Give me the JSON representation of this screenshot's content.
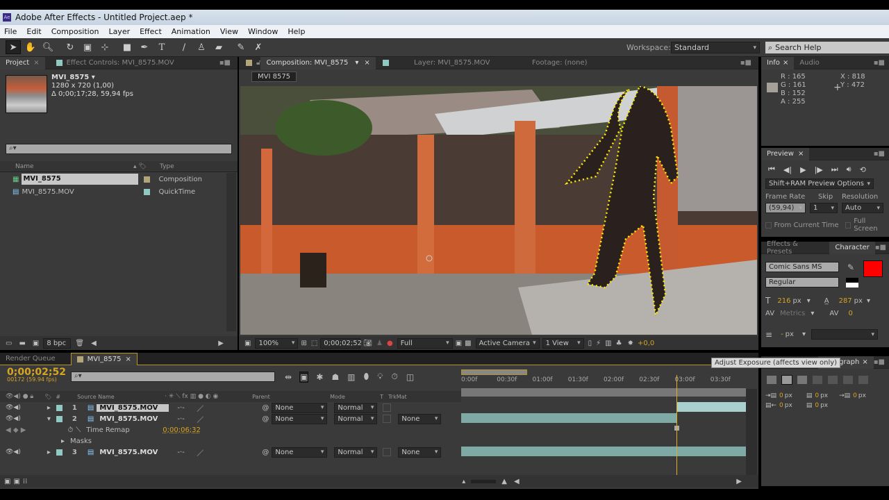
{
  "window": {
    "title": "Adobe After Effects - Untitled Project.aep *",
    "app_badge": "Ae"
  },
  "menu": [
    "File",
    "Edit",
    "Composition",
    "Layer",
    "Effect",
    "Animation",
    "View",
    "Window",
    "Help"
  ],
  "toolbar": {
    "tools": [
      "selection-tool",
      "hand-tool",
      "zoom-tool",
      "rotation-tool",
      "camera-tool",
      "pan-behind-tool",
      "rectangle-tool",
      "pen-tool",
      "type-tool",
      "brush-tool",
      "clone-stamp-tool",
      "eraser-tool",
      "roto-brush-tool",
      "puppet-pin-tool"
    ],
    "workspace_label": "Workspace:",
    "workspace_value": "Standard",
    "search_help_placeholder": "Search Help"
  },
  "project_panel": {
    "tabs": [
      "Project",
      "Effect Controls: MVI_8575.MOV"
    ],
    "item_name": "MVI_8575 ▾",
    "item_resolution": "1280 x 720 (1,00)",
    "item_duration": "Δ 0;00;17;28, 59,94 fps",
    "search_placeholder": "",
    "columns": [
      "Name",
      "Type"
    ],
    "items": [
      {
        "name": "MVI_8575",
        "type": "Composition",
        "label_color": "#b3a57a",
        "selected": true
      },
      {
        "name": "MVI_8575.MOV",
        "type": "QuickTime",
        "label_color": "#8fc9c2",
        "selected": false
      }
    ],
    "bpc": "8 bpc"
  },
  "comp_panel": {
    "tabs": [
      "Composition: MVI_8575",
      "Layer: MVI_8575.MOV",
      "Footage: (none)"
    ],
    "breadcrumb": "MVI 8575",
    "zoom": "100%",
    "timecode": "0;00;02;52",
    "resolution": "Full",
    "camera": "Active Camera",
    "views": "1 View",
    "exposure": "+0,0"
  },
  "tooltip": "Adjust Exposure (affects view only)",
  "info_panel": {
    "tabs": [
      "Info",
      "Audio"
    ],
    "r": "165",
    "g": "161",
    "b": "152",
    "a": "255",
    "x": "818",
    "y": "472",
    "swatch_color": "#a5a198"
  },
  "preview_panel": {
    "tab": "Preview",
    "ram_options": "Shift+RAM Preview Options",
    "frame_rate_label": "Frame Rate",
    "skip_label": "Skip",
    "resolution_label": "Resolution",
    "frame_rate": "(59,94)",
    "skip": "1",
    "resolution": "Auto",
    "from_current_time": "From Current Time",
    "full_screen": "Full Screen"
  },
  "character_panel": {
    "tabs": [
      "Effects & Presets",
      "Character"
    ],
    "font": "Comic Sans MS",
    "style": "Regular",
    "font_size": "216",
    "leading": "287",
    "kerning": "Metrics",
    "tracking": "0",
    "stroke_width": "-",
    "unit": "px",
    "fill_color": "#ff0000"
  },
  "paragraph_panel": {
    "tab": "Paragraph",
    "indent_left": "0",
    "indent_first": "0",
    "indent_right": "0",
    "space_before": "0",
    "space_after": "0",
    "unit": "px"
  },
  "timeline": {
    "tabs": [
      "Render Queue",
      "MVI_8575"
    ],
    "current_time": "0;00;02;52",
    "frame_info": "00172 (59.94 fps)",
    "columns": {
      "num": "#",
      "source": "Source Name",
      "parent": "Parent",
      "mode": "Mode",
      "t": "T",
      "trkmat": "TrkMat"
    },
    "ruler": [
      "0:00f",
      "00:30f",
      "01:00f",
      "01:30f",
      "02:00f",
      "02:30f",
      "03:00f",
      "03:30f"
    ],
    "playhead_fraction": 0.755,
    "layers": [
      {
        "num": "1",
        "name": "MVI_8575.MOV",
        "parent": "None",
        "mode": "Normal",
        "trkmat": "",
        "bar_start": 0.755,
        "bar_end": 1.0
      },
      {
        "num": "2",
        "name": "MVI_8575.MOV",
        "parent": "None",
        "mode": "Normal",
        "trkmat": "None",
        "bar_start": 0.0,
        "bar_end": 0.755
      },
      {
        "num": "3",
        "name": "MVI_8575.MOV",
        "parent": "None",
        "mode": "Normal",
        "trkmat": "None",
        "bar_start": 0.0,
        "bar_end": 1.0
      }
    ],
    "time_remap_label": "Time Remap",
    "time_remap_value": "0;00;06;32",
    "masks_label": "Masks"
  }
}
